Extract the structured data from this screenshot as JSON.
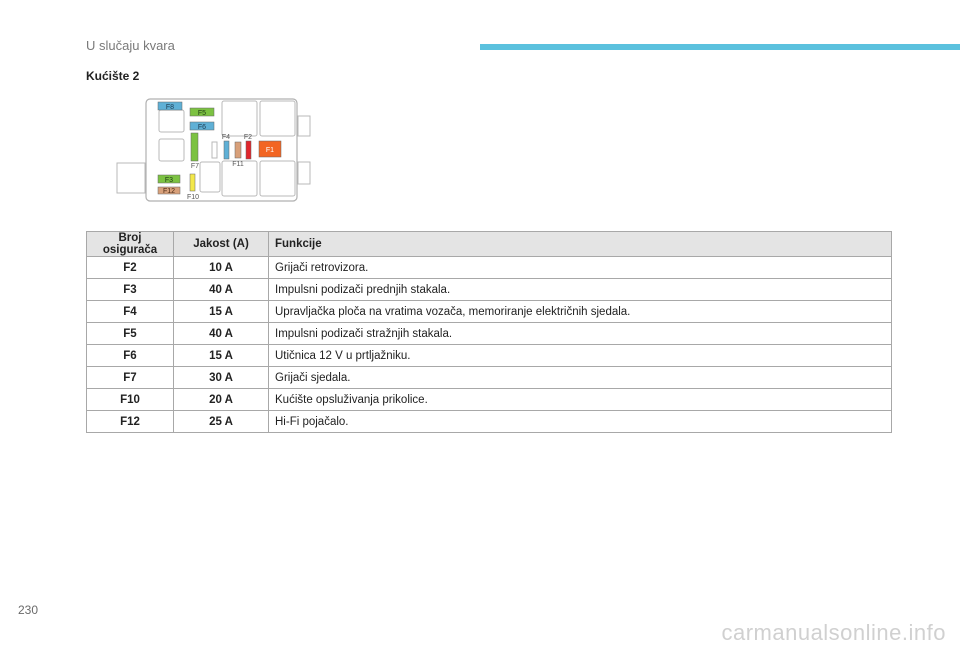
{
  "header": {
    "title": "U slučaju kvara",
    "accent_color": "#5bc1de"
  },
  "section": {
    "title": "Kućište 2"
  },
  "diagram": {
    "labels": {
      "f8": "F8",
      "f5": "F5",
      "f6": "F6",
      "f4": "F4",
      "f2": "F2",
      "f1": "F1",
      "f7": "F7",
      "f11": "F11",
      "f3": "F3",
      "f12": "F12",
      "f10": "F10"
    },
    "fuse_colors": {
      "blue": "#5fb0d6",
      "green": "#7cc242",
      "tan": "#d8a07a",
      "red": "#e0262c",
      "orange": "#f26522",
      "yellow": "#f3e84a"
    }
  },
  "table": {
    "headers": {
      "num": "Broj osigurača",
      "amp": "Jakost (A)",
      "fn": "Funkcije"
    },
    "rows": [
      {
        "num": "F2",
        "amp": "10 A",
        "fn": "Grijači retrovizora."
      },
      {
        "num": "F3",
        "amp": "40 A",
        "fn": "Impulsni podizači prednjih stakala."
      },
      {
        "num": "F4",
        "amp": "15 A",
        "fn": "Upravljačka ploča na vratima vozača, memoriranje električnih sjedala."
      },
      {
        "num": "F5",
        "amp": "40 A",
        "fn": "Impulsni podizači stražnjih stakala."
      },
      {
        "num": "F6",
        "amp": "15 A",
        "fn": "Utičnica 12 V u prtljažniku."
      },
      {
        "num": "F7",
        "amp": "30 A",
        "fn": "Grijači sjedala."
      },
      {
        "num": "F10",
        "amp": "20 A",
        "fn": "Kućište opsluživanja prikolice."
      },
      {
        "num": "F12",
        "amp": "25 A",
        "fn": "Hi-Fi pojačalo."
      }
    ]
  },
  "footer": {
    "page_number": "230",
    "watermark": "carmanualsonline.info"
  }
}
